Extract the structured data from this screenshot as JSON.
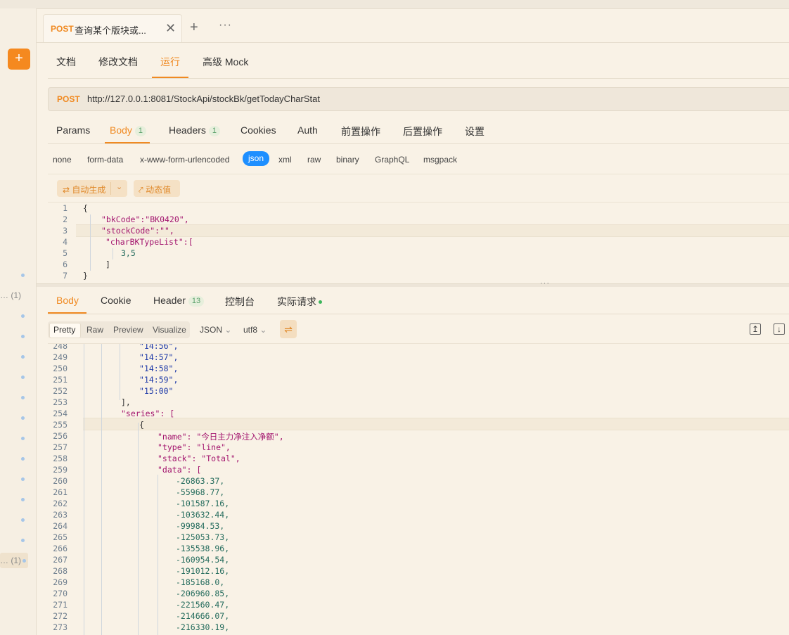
{
  "tab": {
    "method": "POST",
    "title": "查询某个版块或...",
    "close": "✕",
    "add": "+",
    "more": "···"
  },
  "doc_tabs": [
    "文档",
    "修改文档",
    "运行",
    "高级 Mock"
  ],
  "request": {
    "method": "POST",
    "url": "http://127.0.0.1:8081/StockApi/stockBk/getTodayCharStat"
  },
  "req_tabs": {
    "params": "Params",
    "body": "Body",
    "body_count": "1",
    "headers": "Headers",
    "headers_count": "1",
    "cookies": "Cookies",
    "auth": "Auth",
    "pre": "前置操作",
    "post": "后置操作",
    "settings": "设置"
  },
  "body_types": [
    "none",
    "form-data",
    "x-www-form-urlencoded",
    "json",
    "xml",
    "raw",
    "binary",
    "GraphQL",
    "msgpack"
  ],
  "body_tools": {
    "auto_generate": "自动生成",
    "dynamic_value": "动态值"
  },
  "request_body_lines": [
    {
      "n": "1",
      "t": "{"
    },
    {
      "n": "2",
      "t": "\"bkCode\":\"BK0420\","
    },
    {
      "n": "3",
      "t": "\"stockCode\":\"\","
    },
    {
      "n": "4",
      "t": "\"charBKTypeList\":["
    },
    {
      "n": "5",
      "t": "3,5"
    },
    {
      "n": "6",
      "t": "]"
    },
    {
      "n": "7",
      "t": "}"
    }
  ],
  "resp_tabs": {
    "body": "Body",
    "cookie": "Cookie",
    "header": "Header",
    "header_count": "13",
    "console": "控制台",
    "actual": "实际请求"
  },
  "resp_view": {
    "pretty": "Pretty",
    "raw": "Raw",
    "preview": "Preview",
    "visualize": "Visualize",
    "format": "JSON",
    "encoding": "utf8"
  },
  "sidebar_counts": [
    "(1)",
    "(1)"
  ],
  "response_lines": [
    {
      "n": "248",
      "t": "\"14:56\","
    },
    {
      "n": "249",
      "t": "\"14:57\","
    },
    {
      "n": "250",
      "t": "\"14:58\","
    },
    {
      "n": "251",
      "t": "\"14:59\","
    },
    {
      "n": "252",
      "t": "\"15:00\""
    },
    {
      "n": "253",
      "t": "],"
    },
    {
      "n": "254",
      "t": "\"series\": ["
    },
    {
      "n": "255",
      "t": "{"
    },
    {
      "n": "256",
      "t": "\"name\": \"今日主力净注入净额\","
    },
    {
      "n": "257",
      "t": "\"type\": \"line\","
    },
    {
      "n": "258",
      "t": "\"stack\": \"Total\","
    },
    {
      "n": "259",
      "t": "\"data\": ["
    },
    {
      "n": "260",
      "t": "-26863.37,"
    },
    {
      "n": "261",
      "t": "-55968.77,"
    },
    {
      "n": "262",
      "t": "-101587.16,"
    },
    {
      "n": "263",
      "t": "-103632.44,"
    },
    {
      "n": "264",
      "t": "-99984.53,"
    },
    {
      "n": "265",
      "t": "-125053.73,"
    },
    {
      "n": "266",
      "t": "-135538.96,"
    },
    {
      "n": "267",
      "t": "-160954.54,"
    },
    {
      "n": "268",
      "t": "-191012.16,"
    },
    {
      "n": "269",
      "t": "-185168.0,"
    },
    {
      "n": "270",
      "t": "-206960.85,"
    },
    {
      "n": "271",
      "t": "-221560.47,"
    },
    {
      "n": "272",
      "t": "-214666.07,"
    },
    {
      "n": "273",
      "t": "-216330.19,"
    }
  ],
  "colors": {
    "accent": "#f08a22",
    "json_pill": "#1e8fff",
    "background": "#f9f2e6"
  },
  "icons": {
    "plus": "plus-icon",
    "wrap": "wrap-lines-icon",
    "scroll_top": "scroll-top-icon",
    "download": "download-icon"
  }
}
